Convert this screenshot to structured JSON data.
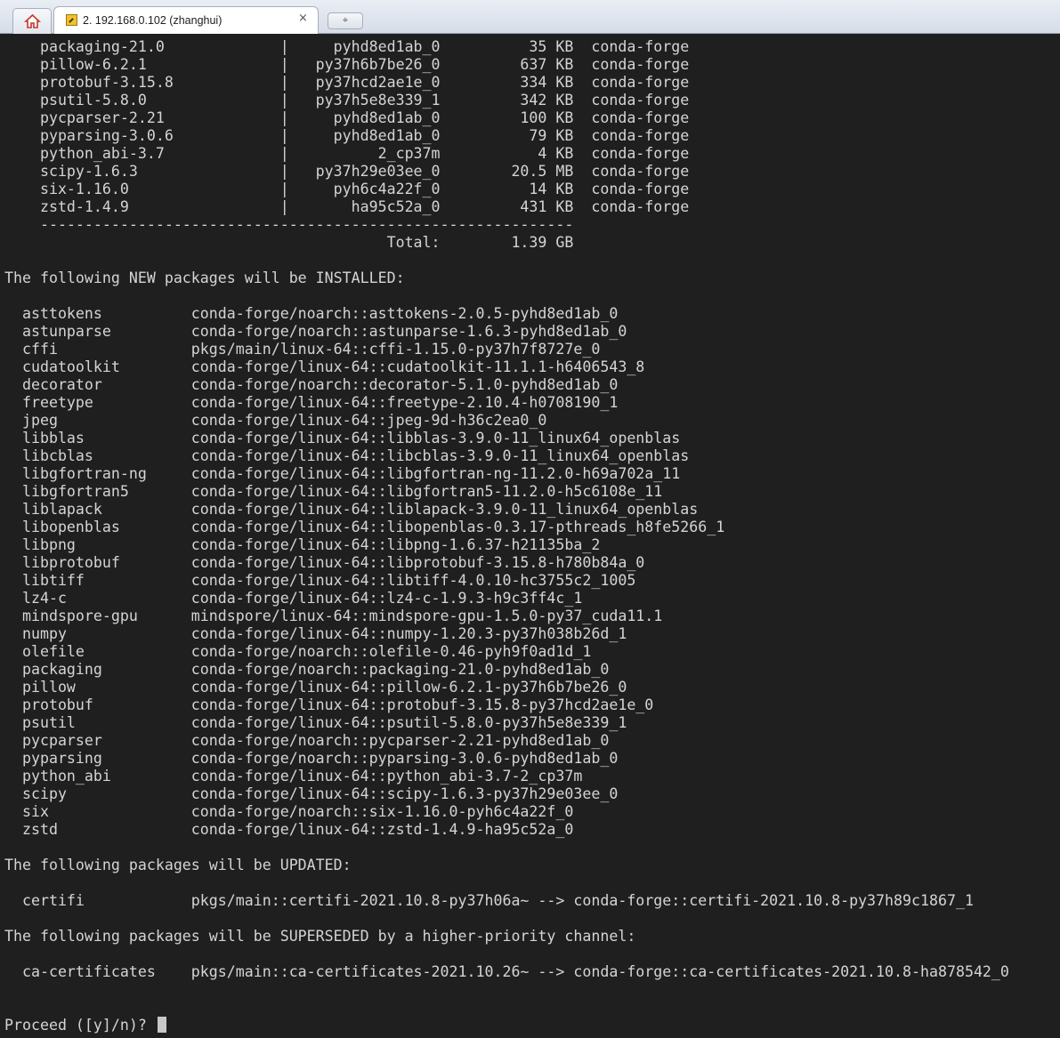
{
  "tabs": {
    "home_icon": "home-icon",
    "active_tab_label": "2. 192.168.0.102 (zhanghui)",
    "close_symbol": "×",
    "new_tab_symbol": "⌖"
  },
  "terminal": {
    "lines": [
      "    packaging-21.0             |     pyhd8ed1ab_0          35 KB  conda-forge",
      "    pillow-6.2.1               |   py37h6b7be26_0         637 KB  conda-forge",
      "    protobuf-3.15.8            |   py37hcd2ae1e_0         334 KB  conda-forge",
      "    psutil-5.8.0               |   py37h5e8e339_1         342 KB  conda-forge",
      "    pycparser-2.21             |     pyhd8ed1ab_0         100 KB  conda-forge",
      "    pyparsing-3.0.6            |     pyhd8ed1ab_0          79 KB  conda-forge",
      "    python_abi-3.7             |          2_cp37m           4 KB  conda-forge",
      "    scipy-1.6.3                |   py37h29e03ee_0        20.5 MB  conda-forge",
      "    six-1.16.0                 |     pyh6c4a22f_0          14 KB  conda-forge",
      "    zstd-1.4.9                 |       ha95c52a_0         431 KB  conda-forge",
      "    ------------------------------------------------------------",
      "                                           Total:        1.39 GB",
      "",
      "The following NEW packages will be INSTALLED:",
      "",
      "  asttokens          conda-forge/noarch::asttokens-2.0.5-pyhd8ed1ab_0",
      "  astunparse         conda-forge/noarch::astunparse-1.6.3-pyhd8ed1ab_0",
      "  cffi               pkgs/main/linux-64::cffi-1.15.0-py37h7f8727e_0",
      "  cudatoolkit        conda-forge/linux-64::cudatoolkit-11.1.1-h6406543_8",
      "  decorator          conda-forge/noarch::decorator-5.1.0-pyhd8ed1ab_0",
      "  freetype           conda-forge/linux-64::freetype-2.10.4-h0708190_1",
      "  jpeg               conda-forge/linux-64::jpeg-9d-h36c2ea0_0",
      "  libblas            conda-forge/linux-64::libblas-3.9.0-11_linux64_openblas",
      "  libcblas           conda-forge/linux-64::libcblas-3.9.0-11_linux64_openblas",
      "  libgfortran-ng     conda-forge/linux-64::libgfortran-ng-11.2.0-h69a702a_11",
      "  libgfortran5       conda-forge/linux-64::libgfortran5-11.2.0-h5c6108e_11",
      "  liblapack          conda-forge/linux-64::liblapack-3.9.0-11_linux64_openblas",
      "  libopenblas        conda-forge/linux-64::libopenblas-0.3.17-pthreads_h8fe5266_1",
      "  libpng             conda-forge/linux-64::libpng-1.6.37-h21135ba_2",
      "  libprotobuf        conda-forge/linux-64::libprotobuf-3.15.8-h780b84a_0",
      "  libtiff            conda-forge/linux-64::libtiff-4.0.10-hc3755c2_1005",
      "  lz4-c              conda-forge/linux-64::lz4-c-1.9.3-h9c3ff4c_1",
      "  mindspore-gpu      mindspore/linux-64::mindspore-gpu-1.5.0-py37_cuda11.1",
      "  numpy              conda-forge/linux-64::numpy-1.20.3-py37h038b26d_1",
      "  olefile            conda-forge/noarch::olefile-0.46-pyh9f0ad1d_1",
      "  packaging          conda-forge/noarch::packaging-21.0-pyhd8ed1ab_0",
      "  pillow             conda-forge/linux-64::pillow-6.2.1-py37h6b7be26_0",
      "  protobuf           conda-forge/linux-64::protobuf-3.15.8-py37hcd2ae1e_0",
      "  psutil             conda-forge/linux-64::psutil-5.8.0-py37h5e8e339_1",
      "  pycparser          conda-forge/noarch::pycparser-2.21-pyhd8ed1ab_0",
      "  pyparsing          conda-forge/noarch::pyparsing-3.0.6-pyhd8ed1ab_0",
      "  python_abi         conda-forge/linux-64::python_abi-3.7-2_cp37m",
      "  scipy              conda-forge/linux-64::scipy-1.6.3-py37h29e03ee_0",
      "  six                conda-forge/noarch::six-1.16.0-pyh6c4a22f_0",
      "  zstd               conda-forge/linux-64::zstd-1.4.9-ha95c52a_0",
      "",
      "The following packages will be UPDATED:",
      "",
      "  certifi            pkgs/main::certifi-2021.10.8-py37h06a~ --> conda-forge::certifi-2021.10.8-py37h89c1867_1",
      "",
      "The following packages will be SUPERSEDED by a higher-priority channel:",
      "",
      "  ca-certificates    pkgs/main::ca-certificates-2021.10.26~ --> conda-forge::ca-certificates-2021.10.8-ha878542_0",
      "",
      ""
    ],
    "prompt": "Proceed ([y]/n)? "
  }
}
